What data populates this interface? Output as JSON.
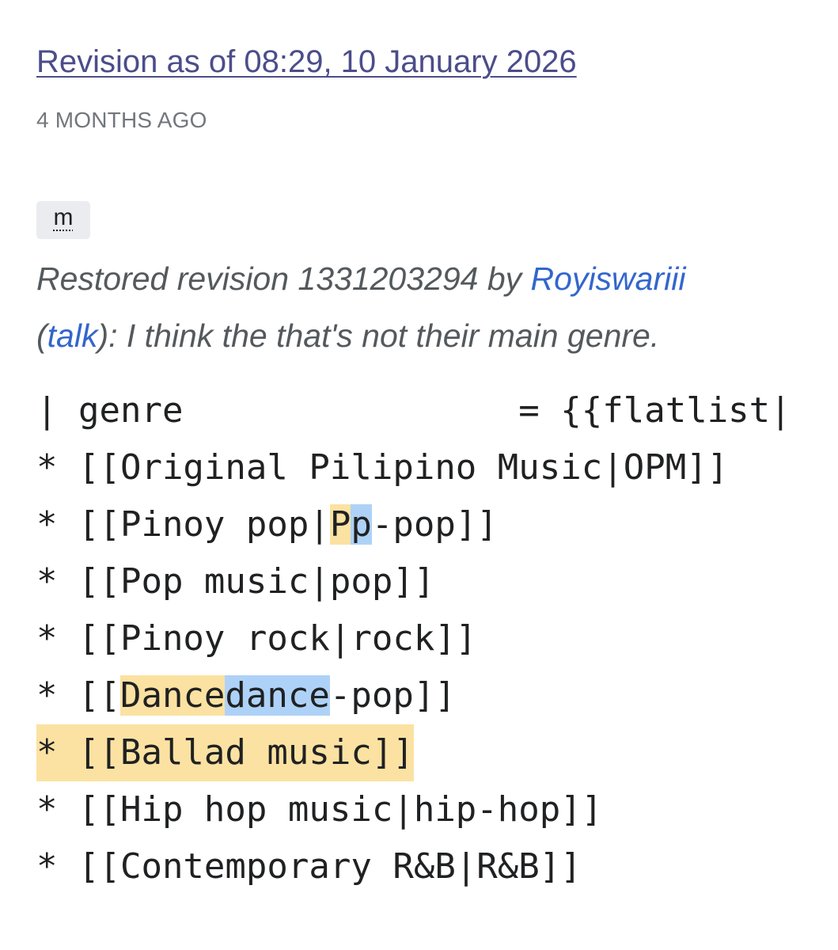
{
  "revision": {
    "title": "Revision as of 08:29, 10 January 2026",
    "age": "4 MONTHS AGO",
    "minor_flag": "m"
  },
  "summary": {
    "prefix": "Restored revision 1331203294 by ",
    "user": "Royiswariii",
    "open_paren": "(",
    "talk": "talk",
    "rest": "): I think the that's not their main genre."
  },
  "diff": {
    "line1": "| genre                = {{flatlist|",
    "line2": "* [[Original Pilipino Music|OPM]]",
    "line3_a": "* [[Pinoy pop|",
    "line3_del": "P",
    "line3_ins": "p",
    "line3_b": "-pop]]",
    "line4": "* [[Pop music|pop]]",
    "line5": "* [[Pinoy rock|rock]]",
    "line6_a": "* [[",
    "line6_del": "Dance",
    "line6_ins": "dance",
    "line6_b": "-pop]]",
    "line7": "* [[Ballad music]]",
    "line8": "* [[Hip hop music|hip-hop]]",
    "line9": "* [[Contemporary R&B|R&B]]"
  },
  "colors": {
    "link": "#4b4d8a",
    "user_link": "#3366cc",
    "deleted_highlight": "#fbe2a2",
    "inserted_highlight": "#aed2f7"
  }
}
